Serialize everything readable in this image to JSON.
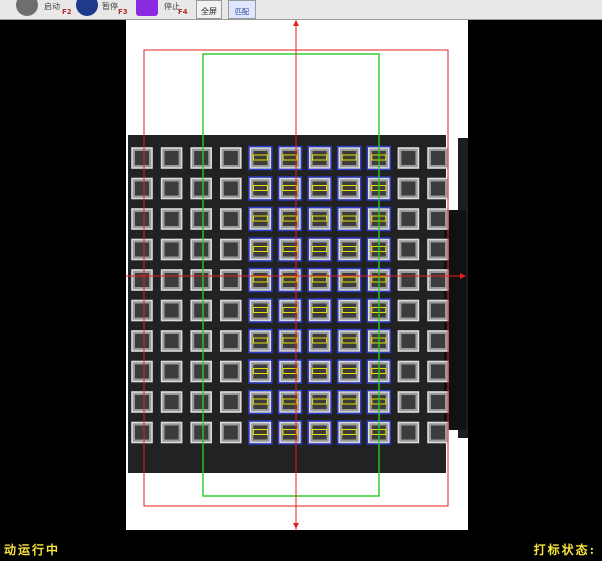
{
  "toolbar": {
    "start": {
      "label": "启动",
      "key": "F2",
      "color": "#6e6e6e"
    },
    "pause": {
      "label": "暂停",
      "key": "F3",
      "color": "#1f3a8a"
    },
    "stop": {
      "label": "停止",
      "key": "F4",
      "color": "#8a2be2"
    },
    "fullscreen_label": "全屏",
    "match_label": "匹配"
  },
  "status": {
    "run_state": "动运行中",
    "mark_status_label": "打标状态:"
  },
  "colors": {
    "roi_outer": "#e02020",
    "roi_inner": "#22cc22",
    "crosshair": "#e02020",
    "chip_match": "#2e3bd1",
    "chip_mark": "#e8e000"
  },
  "tray": {
    "rows": 10,
    "columns": 11,
    "matched_columns": [
      4,
      5,
      6,
      7,
      8
    ]
  }
}
